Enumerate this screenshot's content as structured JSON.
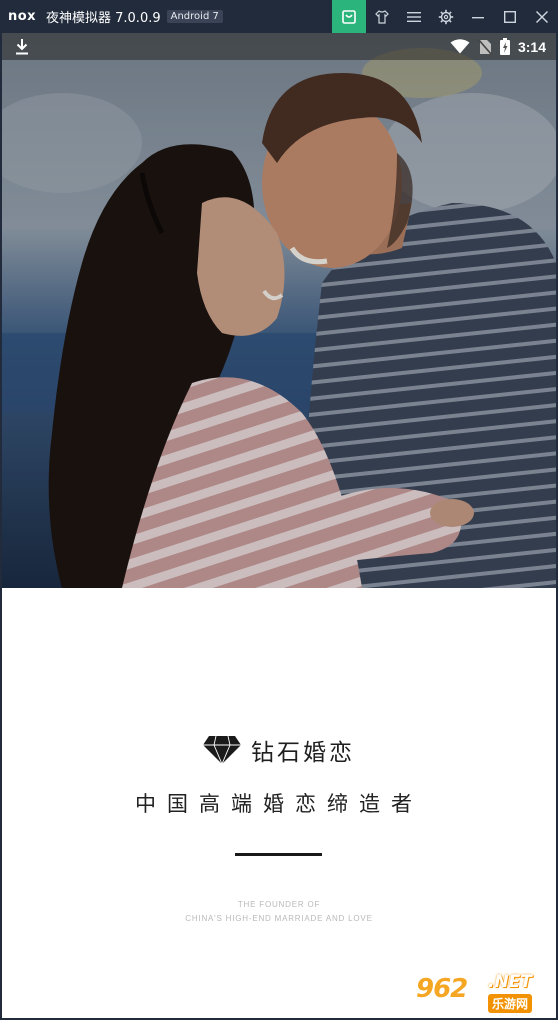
{
  "emulator": {
    "brand": "nox",
    "title": "夜神模拟器 7.0.0.9",
    "android_version": "Android 7",
    "controls": [
      {
        "name": "app-store-icon",
        "active": true
      },
      {
        "name": "shirt-icon"
      },
      {
        "name": "menu-icon"
      },
      {
        "name": "settings-gear-icon"
      },
      {
        "name": "minimize-icon"
      },
      {
        "name": "maximize-icon"
      },
      {
        "name": "close-icon"
      }
    ],
    "colors": {
      "bar": "#212b3b",
      "active": "#2bb57c"
    }
  },
  "status_bar": {
    "left_icon": "download-icon",
    "right_icons": [
      "wifi-icon",
      "no-sim-icon",
      "battery-charging-icon"
    ],
    "time": "3:14"
  },
  "splash": {
    "hero_image": "couple-photo",
    "logo_icon": "diamond-icon",
    "logo_text": "钻石婚恋",
    "slogan": "中国高端婚恋缔造者",
    "english_line1": "THE FOUNDER OF",
    "english_line2": "CHINA'S HIGH-END MARRIADE AND LOVE"
  },
  "watermark": {
    "number": "962",
    "suffix": ".NET",
    "site": "乐游网"
  }
}
